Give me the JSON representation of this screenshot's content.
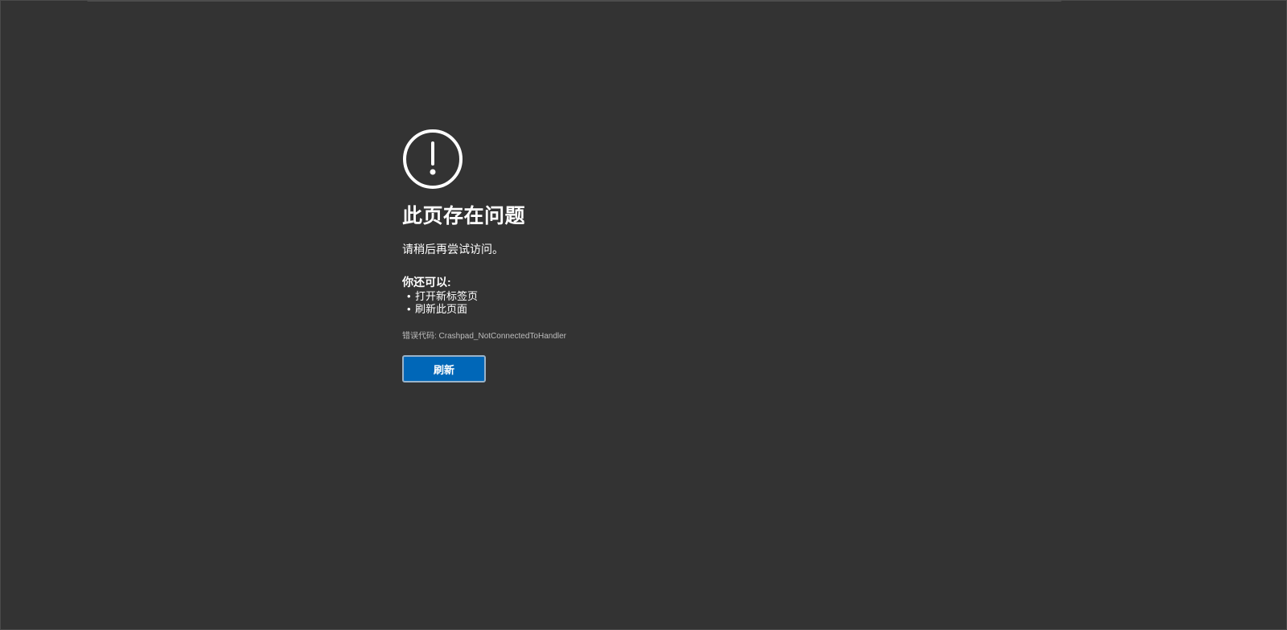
{
  "icon": "exclamation-circle-icon",
  "title": "此页存在问题",
  "subtitle": "请稍后再尝试访问。",
  "suggestions": {
    "heading": "你还可以:",
    "items": [
      {
        "bullet": "•",
        "label": "打开新标签页"
      },
      {
        "bullet": "•",
        "label": "刷新此页面"
      }
    ]
  },
  "error_code": "错误代码: Crashpad_NotConnectedToHandler",
  "refresh_button": {
    "label": "刷新"
  },
  "colors": {
    "background": "#333333",
    "button": "#0067b8",
    "text": "#ffffff",
    "muted_text": "#bdbdbd"
  }
}
